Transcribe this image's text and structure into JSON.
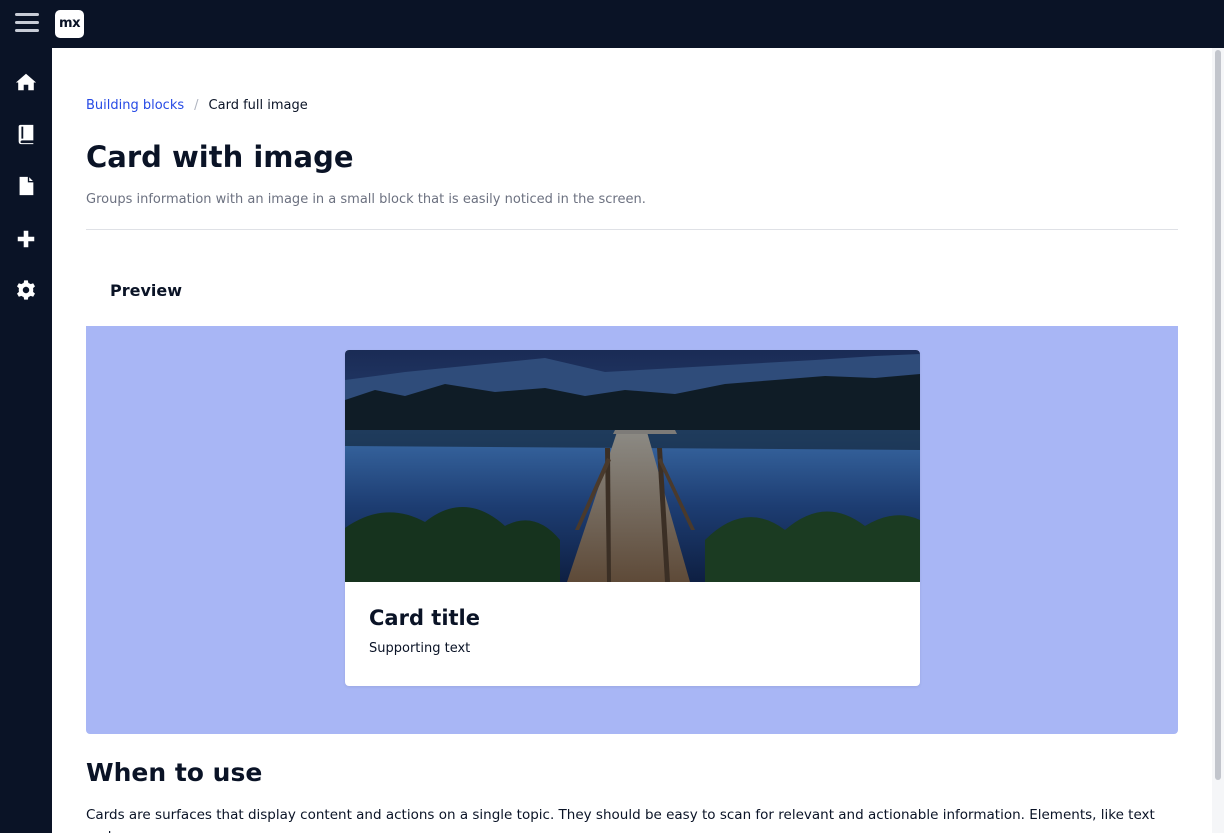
{
  "header": {
    "logo_text": "mx"
  },
  "sidebar": {
    "items": [
      {
        "icon": "home-icon"
      },
      {
        "icon": "book-icon"
      },
      {
        "icon": "document-icon"
      },
      {
        "icon": "plus-icon"
      },
      {
        "icon": "gear-icon"
      }
    ]
  },
  "breadcrumb": {
    "parent": "Building blocks",
    "separator": "/",
    "current": "Card full image"
  },
  "page": {
    "title": "Card with image",
    "subtitle": "Groups information with an image in a small block that is easily noticed in the screen."
  },
  "preview": {
    "label": "Preview",
    "card": {
      "title": "Card title",
      "text": "Supporting text",
      "image": "lake-dock-night-image"
    }
  },
  "section": {
    "title": "When to use",
    "text": "Cards are surfaces that display content and actions on a single topic. They should be easy to scan for relevant and actionable information. Elements, like text and"
  },
  "colors": {
    "nav_bg": "#0a1326",
    "accent": "#264ae5",
    "preview_bg": "#a8b6f5"
  }
}
